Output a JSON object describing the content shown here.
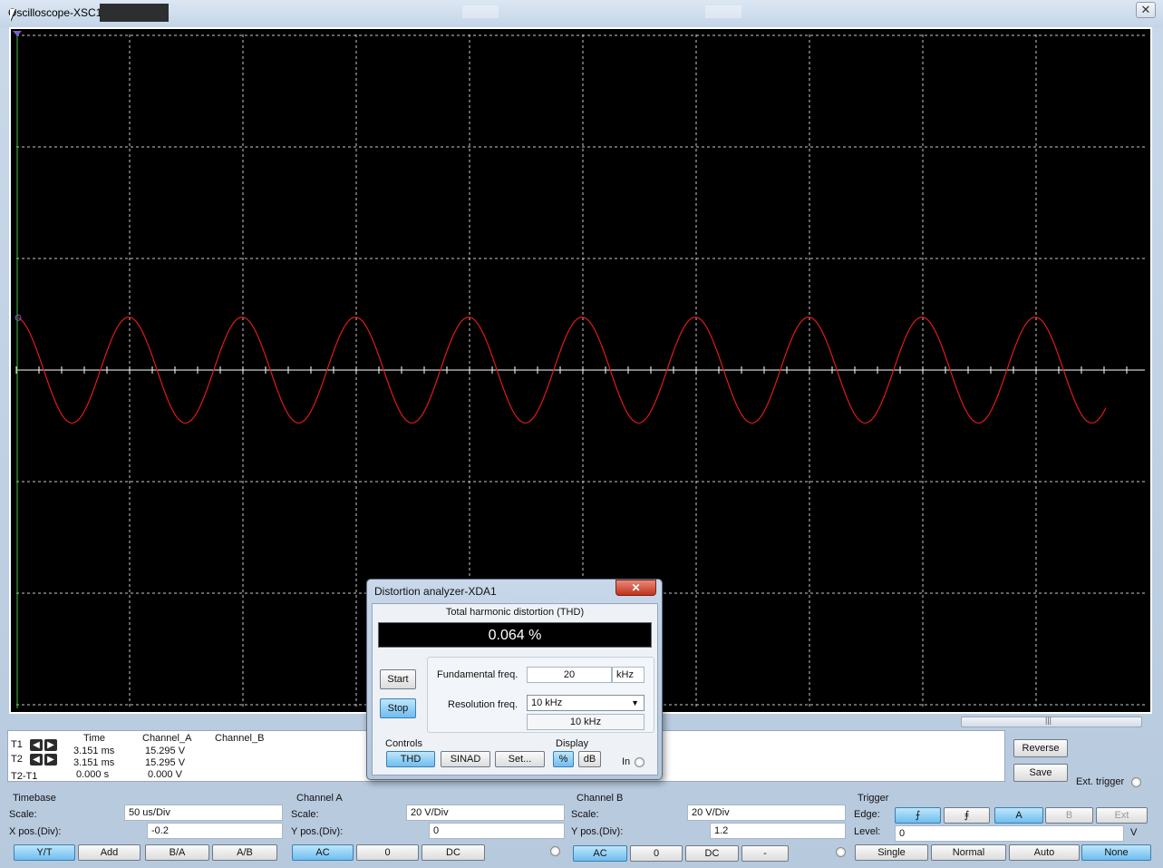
{
  "window": {
    "title": "Oscilloscope-XSC1",
    "close_label": "✕"
  },
  "colors": {
    "trace_a": "#e01a1a",
    "grid": "#c8c8c8",
    "screen_bg": "#000000",
    "active_button": "#6fbdf0"
  },
  "chart_data": {
    "type": "line",
    "title": "",
    "series": [
      {
        "name": "",
        "frequency_khz": 20,
        "amplitude_v": 15.295,
        "color": "#e01a1a"
      }
    ],
    "timebase_us_per_div": 50,
    "volts_per_div": 20,
    "x_divisions": 10,
    "y_divisions": 6,
    "grid": true
  },
  "cursors": {
    "t1_label": "T1",
    "t2_label": "T2",
    "diff_label": "T2-T1",
    "headers": [
      "Time",
      "Channel_A",
      "Channel_B"
    ],
    "rows": [
      [
        "3.151 ms",
        "15.295 V",
        ""
      ],
      [
        "3.151 ms",
        "15.295 V",
        ""
      ],
      [
        "0.000 s",
        "0.000 V",
        ""
      ]
    ]
  },
  "right_buttons": {
    "reverse": "Reverse",
    "save": "Save",
    "ext_trigger": "Ext. trigger"
  },
  "timebase": {
    "label": "Timebase",
    "scale_label": "Scale:",
    "scale": "50 us/Div",
    "xpos_label": "X pos.(Div):",
    "xpos": "-0.2",
    "buttons": [
      "Y/T",
      "Add",
      "B/A",
      "A/B"
    ]
  },
  "channel_a": {
    "label": "Channel A",
    "scale_label": "Scale:",
    "scale": "20  V/Div",
    "ypos_label": "Y pos.(Div):",
    "ypos": "0",
    "buttons": [
      "AC",
      "0",
      "DC"
    ]
  },
  "channel_b": {
    "label": "Channel B",
    "scale_label": "Scale:",
    "scale": "20  V/Div",
    "ypos_label": "Y pos.(Div):",
    "ypos": "1.2",
    "buttons": [
      "AC",
      "0",
      "DC",
      "-"
    ]
  },
  "trigger": {
    "label": "Trigger",
    "edge_label": "Edge:",
    "level_label": "Level:",
    "level": "0",
    "level_unit": "V",
    "edge_buttons": [
      "A",
      "B",
      "Ext"
    ],
    "mode_buttons": [
      "Single",
      "Normal",
      "Auto",
      "None"
    ]
  },
  "distortion": {
    "title": "Distortion analyzer-XDA1",
    "close_label": "✕",
    "thd_label": "Total harmonic distortion (THD)",
    "thd_value": "0.064 %",
    "start": "Start",
    "stop": "Stop",
    "fundamental_label": "Fundamental freq.",
    "fundamental_value": "20",
    "fundamental_unit": "kHz",
    "resolution_label": "Resolution freq.",
    "resolution_value": "10 kHz",
    "resolution_readout": "10 kHz",
    "controls_label": "Controls",
    "display_label": "Display",
    "thd_btn": "THD",
    "sinad_btn": "SINAD",
    "set_btn": "Set...",
    "pct_btn": "%",
    "db_btn": "dB",
    "in_label": "In"
  }
}
